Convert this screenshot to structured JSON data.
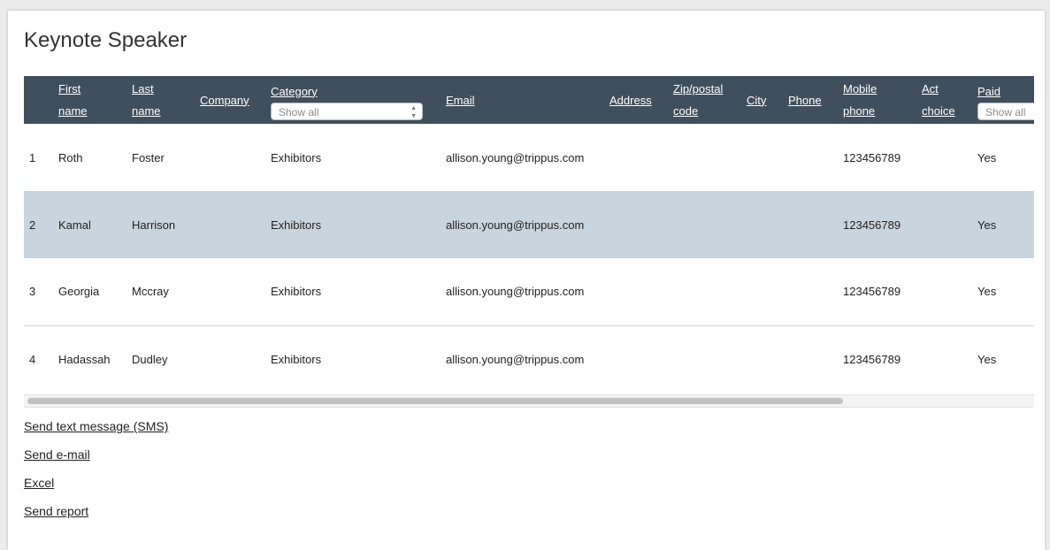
{
  "page": {
    "title": "Keynote Speaker"
  },
  "table": {
    "columns": {
      "first_name": [
        "First",
        "name"
      ],
      "last_name": [
        "Last",
        "name"
      ],
      "company": "Company",
      "category": "Category",
      "email": "Email",
      "address": "Address",
      "zip": [
        "Zip/postal",
        "code"
      ],
      "city": "City",
      "phone": "Phone",
      "mobile": [
        "Mobile",
        "phone"
      ],
      "act_choice": [
        "Act",
        "choice"
      ],
      "paid": "Paid"
    },
    "filters": {
      "category": "Show all",
      "paid": "Show all"
    },
    "rows": [
      {
        "num": "1",
        "first": "Roth",
        "last": "Foster",
        "company": "",
        "category": "Exhibitors",
        "email": "allison.young@trippus.com",
        "address": "",
        "zip": "",
        "city": "",
        "phone": "",
        "mobile": "123456789",
        "act": "",
        "paid": "Yes"
      },
      {
        "num": "2",
        "first": "Kamal",
        "last": "Harrison",
        "company": "",
        "category": "Exhibitors",
        "email": "allison.young@trippus.com",
        "address": "",
        "zip": "",
        "city": "",
        "phone": "",
        "mobile": "123456789",
        "act": "",
        "paid": "Yes"
      },
      {
        "num": "3",
        "first": "Georgia",
        "last": "Mccray",
        "company": "",
        "category": "Exhibitors",
        "email": "allison.young@trippus.com",
        "address": "",
        "zip": "",
        "city": "",
        "phone": "",
        "mobile": "123456789",
        "act": "",
        "paid": "Yes"
      },
      {
        "num": "4",
        "first": "Hadassah",
        "last": "Dudley",
        "company": "",
        "category": "Exhibitors",
        "email": "allison.young@trippus.com",
        "address": "",
        "zip": "",
        "city": "",
        "phone": "",
        "mobile": "123456789",
        "act": "",
        "paid": "Yes"
      }
    ]
  },
  "actions": {
    "sms": "Send text message (SMS)",
    "email": "Send e-mail",
    "excel": "Excel",
    "report": "Send report"
  },
  "colors": {
    "header_bg": "#404f5d",
    "alt_row_bg": "#c9d5de"
  }
}
